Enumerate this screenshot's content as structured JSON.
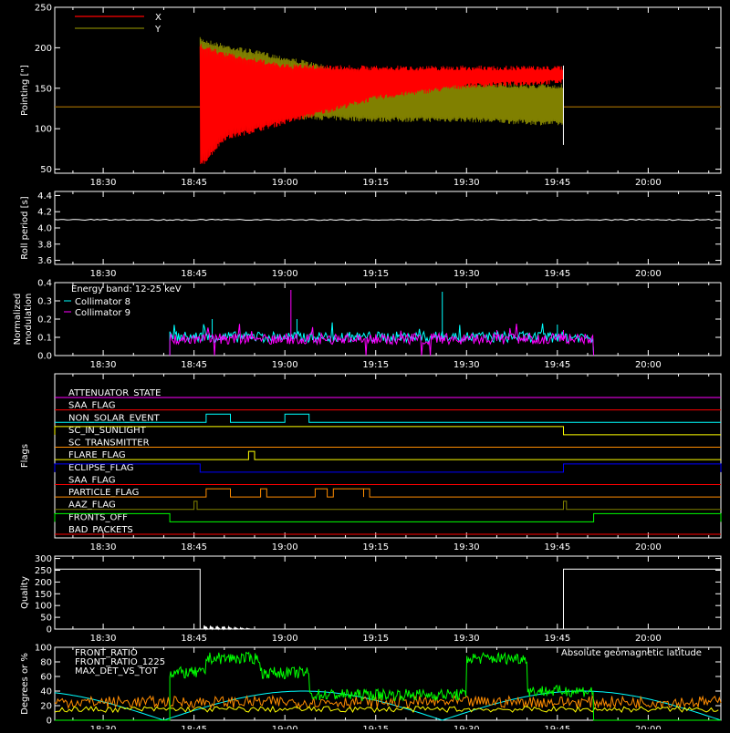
{
  "time_axis": {
    "range": [
      "18:22",
      "20:12"
    ],
    "ticks": [
      "18:30",
      "18:45",
      "19:00",
      "19:15",
      "19:30",
      "19:45",
      "20:00"
    ],
    "minor_step_minutes": 5
  },
  "colors": {
    "background": "#000000",
    "axes": "#ffffff",
    "x": "#ff0000",
    "y": "#808000",
    "coll8": "#00ffff",
    "coll9": "#ff00ff",
    "front_ratio": "#ffff00",
    "front_ratio_1225": "#00ff00",
    "max_det": "#ff8c00",
    "geomag": "#00ffff"
  },
  "chart_data": [
    {
      "type": "area",
      "panel": "pointing",
      "ylabel": "Pointing [\"]",
      "ylim": [
        45,
        250
      ],
      "yticks": [
        "50",
        "100",
        "150",
        "200",
        "250"
      ],
      "legend": [
        "X",
        "Y"
      ],
      "legend_placement": "top-left",
      "series": [
        {
          "name": "X",
          "color": "#ff0000",
          "baseline": 127,
          "envelope_time": [
            "18:46",
            "18:50",
            "19:00",
            "19:15",
            "19:30",
            "19:46"
          ],
          "envelope_lo": [
            50,
            85,
            105,
            135,
            150,
            155
          ],
          "envelope_hi": [
            205,
            195,
            180,
            178,
            178,
            178
          ]
        },
        {
          "name": "Y",
          "color": "#808000",
          "baseline": 127,
          "envelope_time": [
            "18:46",
            "18:50",
            "19:00",
            "19:15",
            "19:30",
            "19:46"
          ],
          "envelope_lo": [
            130,
            118,
            112,
            108,
            108,
            103
          ],
          "envelope_hi": [
            213,
            205,
            190,
            165,
            158,
            155
          ]
        }
      ]
    },
    {
      "type": "line",
      "panel": "roll",
      "ylabel": "Roll period [s]",
      "ylim": [
        3.55,
        4.45
      ],
      "yticks": [
        "3.6",
        "3.8",
        "4.0",
        "4.2",
        "4.4"
      ],
      "series": [
        {
          "name": "",
          "color": "#ffffff",
          "value": 4.1
        }
      ]
    },
    {
      "type": "line",
      "panel": "modulation",
      "ylabel": "Normalized modulation",
      "ylim": [
        0.0,
        0.4
      ],
      "yticks": [
        "0.0",
        "0.1",
        "0.2",
        "0.3",
        "0.4"
      ],
      "annotation": "Energy band: 12-25 keV",
      "data_range": [
        "18:41",
        "19:51"
      ],
      "series": [
        {
          "name": "Collimator 8",
          "color": "#00ffff",
          "typical": 0.09,
          "spikes": [
            [
              "18:48",
              0.2
            ],
            [
              "19:02",
              0.2
            ],
            [
              "19:26",
              0.35
            ],
            [
              "19:45",
              0.17
            ]
          ]
        },
        {
          "name": "Collimator 9",
          "color": "#ff00ff",
          "typical": 0.08,
          "spikes": [
            [
              "19:01",
              0.36
            ],
            [
              "19:21",
              0.12
            ],
            [
              "19:35",
              0.14
            ],
            [
              "19:46",
              0.14
            ]
          ]
        }
      ]
    },
    {
      "type": "line",
      "panel": "flags",
      "ylabel": "Flags",
      "flags": [
        {
          "name": "ATTENUATOR_STATE",
          "color": "#ff00ff",
          "segments": []
        },
        {
          "name": "SAA_FLAG",
          "color": "#ff0000",
          "segments": []
        },
        {
          "name": "NON_SOLAR_EVENT",
          "color": "#00ffff",
          "segments": [
            [
              "18:47",
              "18:51"
            ],
            [
              "19:00",
              "19:04"
            ]
          ]
        },
        {
          "name": "SC_IN_SUNLIGHT",
          "color": "#ffff00",
          "segments": [
            [
              "18:22",
              "19:46"
            ]
          ]
        },
        {
          "name": "SC_TRANSMITTER",
          "color": "#ff8c00",
          "segments": []
        },
        {
          "name": "FLARE_FLAG",
          "color": "#ffff00",
          "segments": [
            [
              "18:54",
              "18:55"
            ]
          ]
        },
        {
          "name": "ECLIPSE_FLAG",
          "color": "#0000ff",
          "segments": [
            [
              "18:22",
              "18:46"
            ],
            [
              "19:46",
              "20:12"
            ]
          ]
        },
        {
          "name": "SAA_FLAG",
          "color": "#ff0000",
          "segments": []
        },
        {
          "name": "PARTICLE_FLAG",
          "color": "#ff8c00",
          "segments": [
            [
              "18:47",
              "18:51"
            ],
            [
              "18:56",
              "18:57"
            ],
            [
              "19:05",
              "19:07"
            ],
            [
              "19:08",
              "19:13"
            ],
            [
              "19:13",
              "19:14"
            ]
          ]
        },
        {
          "name": "AAZ_FLAG",
          "color": "#808000",
          "segments": [
            [
              "18:45",
              "18:45.5"
            ],
            [
              "19:46",
              "19:46.5"
            ]
          ]
        },
        {
          "name": "FRONTS_OFF",
          "color": "#00ff00",
          "segments": [
            [
              "18:22",
              "18:41"
            ],
            [
              "19:51",
              "20:12"
            ]
          ]
        },
        {
          "name": "BAD_PACKETS",
          "color": "#ff0000",
          "segments": []
        }
      ]
    },
    {
      "type": "line",
      "panel": "quality",
      "ylabel": "Quality",
      "ylim": [
        0,
        310
      ],
      "yticks": [
        "0",
        "50",
        "100",
        "150",
        "200",
        "250",
        "300"
      ],
      "series": [
        {
          "name": "",
          "color": "#ffffff",
          "steps": [
            [
              "18:22",
              255
            ],
            [
              "18:46",
              0
            ],
            [
              "19:46",
              255
            ],
            [
              "20:12",
              255
            ]
          ]
        }
      ]
    },
    {
      "type": "line",
      "panel": "ratios",
      "ylabel": "Degrees or %",
      "ylim": [
        0,
        100
      ],
      "yticks": [
        "0",
        "20",
        "40",
        "60",
        "80",
        "100"
      ],
      "annotation": "Absolute geomagnetic latitude",
      "series": [
        {
          "name": "FRONT_RATIO",
          "color": "#ffff00",
          "typical": 15
        },
        {
          "name": "FRONT_RATIO_1225",
          "color": "#00ff00",
          "levels": [
            [
              "18:41",
              "19:04",
              65
            ],
            [
              "18:47",
              "18:56",
              85
            ],
            [
              "19:04",
              "19:30",
              35
            ],
            [
              "19:30",
              "19:40",
              85
            ],
            [
              "19:40",
              "19:51",
              40
            ]
          ]
        },
        {
          "name": "MAX_DET_VS_TOT",
          "color": "#ff8c00",
          "typical": 25
        },
        {
          "name": "Absolute geomagnetic latitude",
          "color": "#00ffff",
          "shape": "zigzag",
          "peak": 40
        }
      ]
    }
  ]
}
